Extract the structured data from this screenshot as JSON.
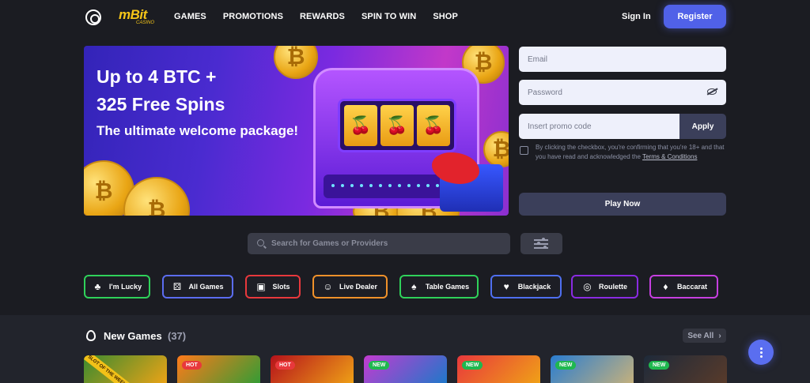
{
  "header": {
    "logo_text": "mBit",
    "logo_sub": "CASINO",
    "nav": [
      "GAMES",
      "PROMOTIONS",
      "REWARDS",
      "SPIN TO WIN",
      "SHOP"
    ],
    "signin_label": "Sign In",
    "register_label": "Register"
  },
  "hero": {
    "title_line1": "Up to 4 BTC +",
    "title_line2": "325 Free Spins",
    "subtitle": "The ultimate welcome package!"
  },
  "form": {
    "email_placeholder": "Email",
    "password_placeholder": "Password",
    "promo_placeholder": "Insert promo code",
    "apply_label": "Apply",
    "consent_text": "By clicking the checkbox, you're confirming that you're 18+ and that you have read and acknowledged the ",
    "consent_link": "Terms & Conditions",
    "play_label": "Play Now"
  },
  "search": {
    "placeholder": "Search for Games or Providers"
  },
  "categories": [
    {
      "label": "I'm Lucky",
      "color": "#2fd15a"
    },
    {
      "label": "All Games",
      "color": "#5b6cf0"
    },
    {
      "label": "Slots",
      "color": "#e8383c"
    },
    {
      "label": "Live Dealer",
      "color": "#f0912a"
    },
    {
      "label": "Table Games",
      "color": "#2fd15a"
    },
    {
      "label": "Blackjack",
      "color": "#4f6ff0"
    },
    {
      "label": "Roulette",
      "color": "#8a2be2"
    },
    {
      "label": "Baccarat",
      "color": "#c63fe0"
    }
  ],
  "new_games": {
    "title": "New Games",
    "count": "(37)",
    "see_all": "See All",
    "ribbon": "SLOT OF THE WEEK",
    "cards": [
      {
        "badge": "",
        "bg": "linear-gradient(135deg,#3c8a2f,#f0a416)"
      },
      {
        "badge": "HOT",
        "bg": "linear-gradient(135deg,#ff7a1a,#2e9d35)"
      },
      {
        "badge": "HOT",
        "bg": "linear-gradient(135deg,#b5121b,#f0a416)"
      },
      {
        "badge": "NEW",
        "bg": "linear-gradient(135deg,#c23bd0,#1a7ac9)"
      },
      {
        "badge": "NEW",
        "bg": "linear-gradient(135deg,#e8383c,#f0a416)"
      },
      {
        "badge": "NEW",
        "bg": "linear-gradient(135deg,#2a7dd0,#c9b27a)"
      },
      {
        "badge": "NEW",
        "bg": "linear-gradient(135deg,#1e2a3a,#5a3b2a)"
      }
    ]
  }
}
